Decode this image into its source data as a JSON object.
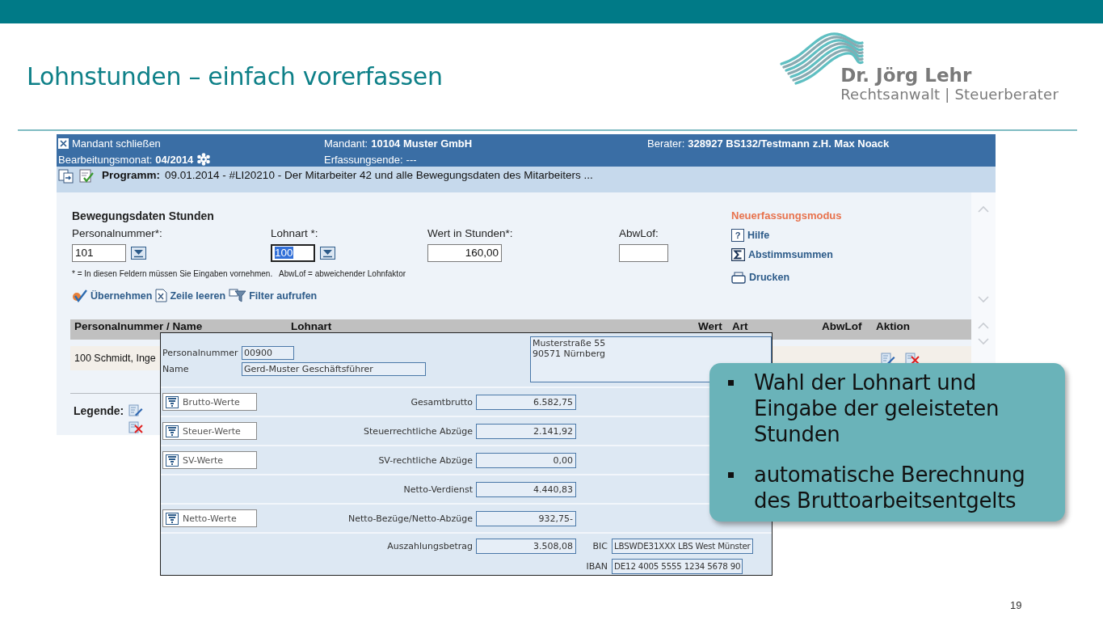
{
  "slide": {
    "title": "Lohnstunden – einfach vorerfassen",
    "page_number": "19"
  },
  "logo": {
    "name": "Dr. Jörg Lehr",
    "tagline": "Rechtsanwalt | Steuerberater"
  },
  "app": {
    "header": {
      "close_label": "Mandant schließen",
      "month_label": "Bearbeitungsmonat:",
      "month_value": "04/2014",
      "client_label": "Mandant:",
      "client_value": "10104 Muster GmbH",
      "end_label": "Erfassungsende:",
      "end_value": "---",
      "advisor_label": "Berater:",
      "advisor_value": "328927 BS132/Testmann z.H. Max Noack"
    },
    "program_bar": {
      "label": "Programm:",
      "text": "09.01.2014 -  #LI20210 - Der Mitarbeiter 42 und alle Bewegungsdaten des Mitarbeiters ..."
    },
    "form": {
      "title": "Bewegungsdaten Stunden",
      "fields": [
        {
          "label": "Personalnummer*:",
          "value": "101",
          "dropdown": true,
          "highlighted": false,
          "kind": "text"
        },
        {
          "label": "Lohnart *:",
          "value": "100",
          "dropdown": true,
          "highlighted": true,
          "kind": "text"
        },
        {
          "label": "Wert in Stunden*:",
          "value": "160,00",
          "dropdown": false,
          "highlighted": false,
          "kind": "number"
        },
        {
          "label": "AbwLof:",
          "dropdown": false,
          "highlighted": false,
          "kind": "text"
        }
      ],
      "help_glyph": "?",
      "note": "* = In diesen Feldern müssen Sie Eingaben vornehmen.   AbwLof = abweichender Lohnfaktor",
      "actions": [
        "Übernehmen",
        "Zeile leeren",
        "Filter aufrufen"
      ],
      "mode": "Neuerfassungsmodus",
      "side_links": [
        "Hilfe",
        "Abstimmsummen",
        "Drucken"
      ]
    },
    "table": {
      "columns": [
        "Personalnummer / Name",
        "Lohnart",
        "Wert",
        "Art",
        "AbwLof",
        "Aktion"
      ],
      "rows": [
        {
          "name": "100 Schmidt, Inge"
        }
      ]
    },
    "legend": {
      "label": "Legende:"
    }
  },
  "popup": {
    "personnel_label": "Personalnummer",
    "personnel_value": "00900",
    "name_label": "Name",
    "name_value": "Gerd-Muster Geschäftsführer",
    "address": [
      "Musterstraße 55",
      "90571 Nürnberg"
    ],
    "rows": [
      {
        "button": "Brutto-Werte",
        "label": "Gesamtbrutto",
        "value": "6.582,75"
      },
      {
        "button": "Steuer-Werte",
        "label": "Steuerrechtliche Abzüge",
        "value": "2.141,92"
      },
      {
        "button": "SV-Werte",
        "label": "SV-rechtliche Abzüge",
        "value": "0,00"
      },
      {
        "label": "Netto-Verdienst",
        "value": "4.440,83"
      },
      {
        "button": "Netto-Werte",
        "label": "Netto-Bezüge/Netto-Abzüge",
        "value": "932,75-"
      },
      {
        "label": "Auszahlungsbetrag",
        "value": "3.508,08",
        "extra_label": "BIC",
        "extra_value": "LBSWDE31XXX LBS West Münster"
      }
    ],
    "iban_label": "IBAN",
    "iban_value": "DE12 4005 5555 1234 5678 90"
  },
  "callout": {
    "bullets": [
      "Wahl der Lohnart und Eingabe der geleisteten Stunden",
      "automatische Berechnung des Bruttoarbeitsentgelts"
    ]
  }
}
